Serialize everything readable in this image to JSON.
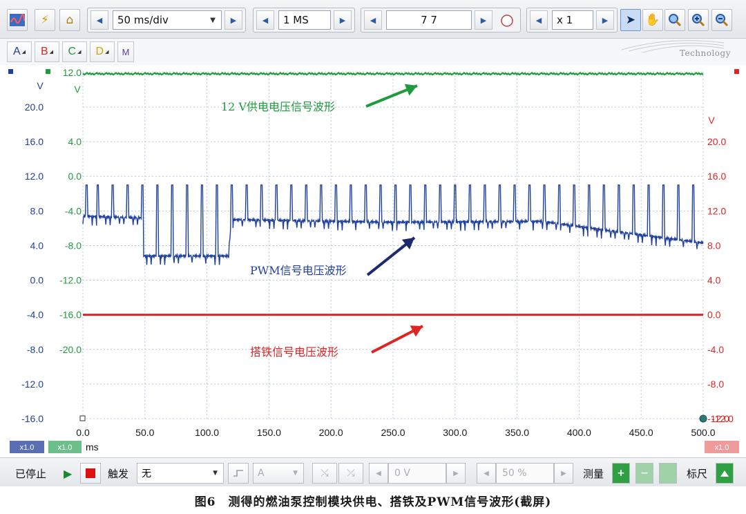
{
  "toolbar": {
    "timebase": "50 ms/div",
    "samples": "1 MS",
    "captures": "7 7",
    "zoom": "x 1"
  },
  "channels": {
    "a": "A",
    "b": "B",
    "c": "C",
    "d": "D",
    "math": "M"
  },
  "brand": "Technology",
  "axes": {
    "axis1_unit": "V",
    "axis2_unit": "V",
    "axis_right_unit": "V",
    "axis1_ticks": [
      "20.0",
      "16.0",
      "12.0",
      "8.0",
      "4.0",
      "0.0",
      "-4.0",
      "-8.0",
      "-12.0",
      "-16.0"
    ],
    "axis2_ticks": [
      "12.0",
      "4.0",
      "0.0",
      "-4.0",
      "-8.0",
      "-12.0",
      "-16.0",
      "-20.0"
    ],
    "axis_right_ticks": [
      "20.0",
      "16.0",
      "12.0",
      "8.0",
      "4.0",
      "0.0",
      "-4.0",
      "-8.0",
      "-12.0"
    ],
    "x_ticks": [
      "0.0",
      "50.0",
      "100.0",
      "150.0",
      "200.0",
      "250.0",
      "300.0",
      "350.0",
      "400.0",
      "450.0",
      "500.0"
    ],
    "x_unit": "ms",
    "scale_left1": "x1.0",
    "scale_left2": "x1.0",
    "scale_right": "x1.0"
  },
  "annotations": {
    "supply": "12 V供电电压信号波形",
    "pwm": "PWM信号电压波形",
    "ground": "搭铁信号电压波形"
  },
  "bottom": {
    "status": "已停止",
    "trigger_label": "触发",
    "trigger_mode": "无",
    "trigger_channel": "A",
    "trigger_level": "0 V",
    "trigger_position": "50 %",
    "measure_label": "测量",
    "ruler_label": "标尺"
  },
  "caption": "图6　测得的燃油泵控制模块供电、搭铁及PWM信号波形(截屏)",
  "colors": {
    "blue": "#1f3f9c",
    "green": "#1f9a3c",
    "red": "#e02424",
    "grid": "#b7c8e0"
  },
  "chart_data": {
    "type": "line",
    "x_range": [
      0,
      500
    ],
    "xlabel": "ms",
    "series": [
      {
        "name": "12 V供电电压信号波形",
        "color": "#1f9a3c",
        "axis": "axis2",
        "baseline": 12.0
      },
      {
        "name": "PWM信号电压波形",
        "color": "#1f3f9c",
        "axis": "axis1",
        "baseline_points": [
          [
            0,
            7.4
          ],
          [
            47,
            7.2
          ],
          [
            48,
            2.8
          ],
          [
            117,
            2.8
          ],
          [
            120,
            7.0
          ],
          [
            250,
            6.7
          ],
          [
            370,
            6.8
          ],
          [
            420,
            5.8
          ],
          [
            500,
            4.3
          ]
        ],
        "pulse_peak": 11.0,
        "pulse_times_ms": [
          3,
          12,
          24,
          36,
          48,
          60,
          72,
          84,
          96,
          108,
          120,
          132,
          144,
          156,
          168,
          180,
          192,
          204,
          216,
          228,
          240,
          252,
          264,
          276,
          288,
          300,
          312,
          324,
          336,
          348,
          360,
          372,
          384,
          396,
          408,
          420,
          432,
          444,
          456,
          468,
          480,
          492
        ]
      },
      {
        "name": "搭铁信号电压波形",
        "color": "#e02424",
        "axis": "axis_right",
        "baseline": 0.0
      }
    ]
  }
}
